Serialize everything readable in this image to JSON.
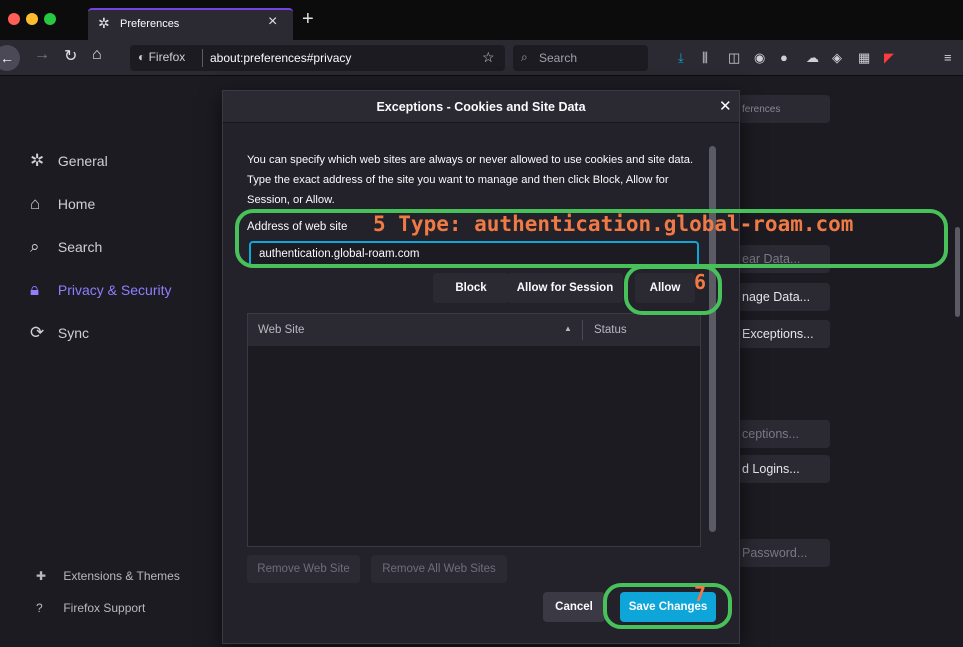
{
  "window": {
    "tab_title": "Preferences",
    "tab_icon": "gear-icon",
    "tab_close": "×",
    "new_tab": "+"
  },
  "toolbar": {
    "identity_chip": "Firefox",
    "url": "about:preferences#privacy",
    "search_placeholder": "Search"
  },
  "sidebar": {
    "items": [
      {
        "label": "General",
        "icon": "gear-icon"
      },
      {
        "label": "Home",
        "icon": "home-icon"
      },
      {
        "label": "Search",
        "icon": "search-icon"
      },
      {
        "label": "Privacy & Security",
        "icon": "lock-icon",
        "active": true
      },
      {
        "label": "Sync",
        "icon": "sync-icon"
      }
    ],
    "footer": [
      {
        "label": "Extensions & Themes",
        "icon": "puzzle-icon"
      },
      {
        "label": "Firefox Support",
        "icon": "help-icon"
      }
    ]
  },
  "background": {
    "find_placeholder": "ferences",
    "buttons": [
      "ear Data...",
      "nage Data...",
      "Exceptions...",
      "ceptions...",
      "d Logins...",
      "Password..."
    ]
  },
  "dialog": {
    "title": "Exceptions - Cookies and Site Data",
    "description": "You can specify which web sites are always or never allowed to use cookies and site data. Type the exact address of the site you want to manage and then click Block, Allow for Session, or Allow.",
    "address_label": "Address of web site",
    "address_value": "authentication.global-roam.com",
    "buttons": {
      "block": "Block",
      "allow_session": "Allow for Session",
      "allow": "Allow",
      "remove_site": "Remove Web Site",
      "remove_all": "Remove All Web Sites",
      "cancel": "Cancel",
      "save": "Save Changes"
    },
    "table": {
      "col_site": "Web Site",
      "col_status": "Status",
      "sort_indicator": "▲",
      "rows": []
    }
  },
  "annotations": {
    "step5": "5 Type: authentication.global-roam.com",
    "step6": "6",
    "step7": "7",
    "ring_color": "#48c15a",
    "text_color": "#f07a45"
  },
  "colors": {
    "accent": "#0ea5d8",
    "active_category": "#8f7fff",
    "tab_highlight": "#7542e5"
  }
}
